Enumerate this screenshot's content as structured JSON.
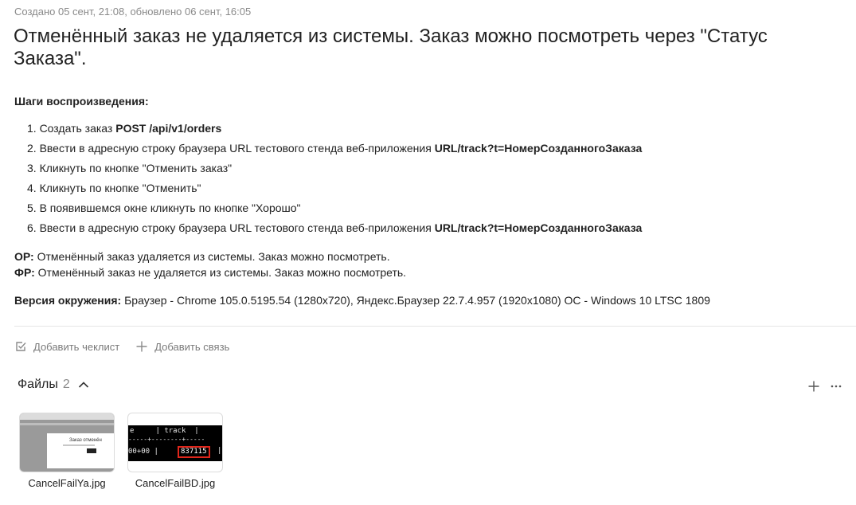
{
  "meta": "Создано 05 сент, 21:08, обновлено 06 сент, 16:05",
  "title": "Отменённый заказ не удаляется из системы. Заказ можно посмотреть через \"Статус Заказа\".",
  "steps_heading": "Шаги воспроизведения:",
  "steps": [
    {
      "text": "1. Создать заказ ",
      "bold": "POST /api/v1/orders"
    },
    {
      "text": "2. Ввести в адресную строку браузера URL тестового стенда веб-приложения ",
      "bold": "URL/track?t=НомерСозданногоЗаказа"
    },
    {
      "text": "3. Кликнуть по кнопке \"Отменить заказ\"",
      "bold": ""
    },
    {
      "text": "4. Кликнуть по кнопке \"Отменить\"",
      "bold": ""
    },
    {
      "text": "5. В появившемся окне кликнуть по кнопке \"Хорошо\"",
      "bold": ""
    },
    {
      "text": "6. Ввести в адресную строку браузера URL тестового стенда веб-приложения ",
      "bold": "URL/track?t=НомерСозданногоЗаказа"
    }
  ],
  "or": {
    "label": "ОР:",
    "text": " Отменённый заказ удаляется из системы. Заказ можно посмотреть."
  },
  "fr": {
    "label": "ФР:",
    "text": " Отменённый заказ не удаляется из системы. Заказ можно посмотреть."
  },
  "env": {
    "label": "Версия окружения:",
    "text": " Браузер - Chrome 105.0.5195.54 (1280x720), Яндекс.Браузер 22.7.4.957 (1920x1080) ОС - Windows 10 LTSC 1809"
  },
  "actions": {
    "checklist": "Добавить чеклист",
    "link": "Добавить связь"
  },
  "files": {
    "label": "Файлы",
    "count": "2",
    "items": [
      {
        "name": "CancelFailYa.jpg",
        "thumb_text": "Заказ отменён"
      },
      {
        "name": "CancelFailBD.jpg",
        "thumb_header": "e     | track  |",
        "thumb_dash": "-----+--------+-----",
        "thumb_row": "00+00 |",
        "thumb_track": "837115",
        "thumb_bar": "|"
      }
    ]
  },
  "icons": {
    "checklist": "checkbox-icon",
    "link": "plus-icon",
    "collapse": "chevron-up-icon",
    "add_file": "plus-icon",
    "more": "more-icon"
  },
  "colors": {
    "muted": "#8a8a8a",
    "text": "#222222",
    "highlight": "#e0261b"
  }
}
